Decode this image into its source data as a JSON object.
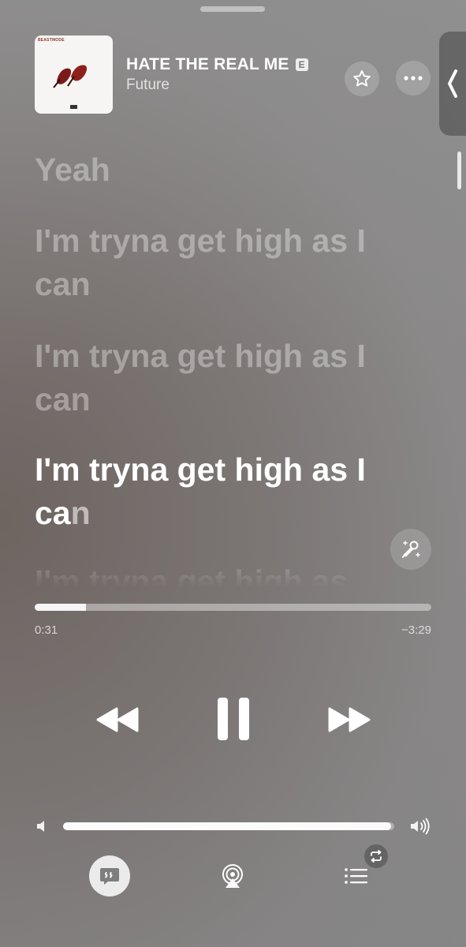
{
  "now_playing": {
    "title": "HATE THE REAL ME",
    "explicit_badge": "E",
    "artist": "Future",
    "album_art_label": "BEASTMODE"
  },
  "lyrics": {
    "lines": [
      "Yeah",
      "I'm tryna get high as I can",
      "I'm tryna get high as I can",
      "I'm tryna get high as I can",
      "I'm tryna get high as"
    ],
    "active_line": {
      "sung": "I'm tryna get high as I ca",
      "unsung": "n"
    }
  },
  "playback": {
    "elapsed": "0:31",
    "remaining": "−3:29",
    "progress": 0.13,
    "is_playing": true
  },
  "volume": {
    "level": 0.99
  },
  "colors": {
    "background": "#8a8888",
    "text": "#ffffff"
  },
  "icons": {
    "favorite": "star-icon",
    "more": "ellipsis-icon",
    "side_panel": "chevron-left-icon",
    "sing": "microphone-sparkle-icon",
    "rewind": "backward-icon",
    "pause": "pause-icon",
    "forward": "forward-icon",
    "volume_low": "speaker-low-icon",
    "volume_high": "speaker-high-icon",
    "lyrics": "lyrics-quote-icon",
    "airplay": "airplay-icon",
    "queue": "list-icon",
    "repeat": "repeat-icon"
  }
}
